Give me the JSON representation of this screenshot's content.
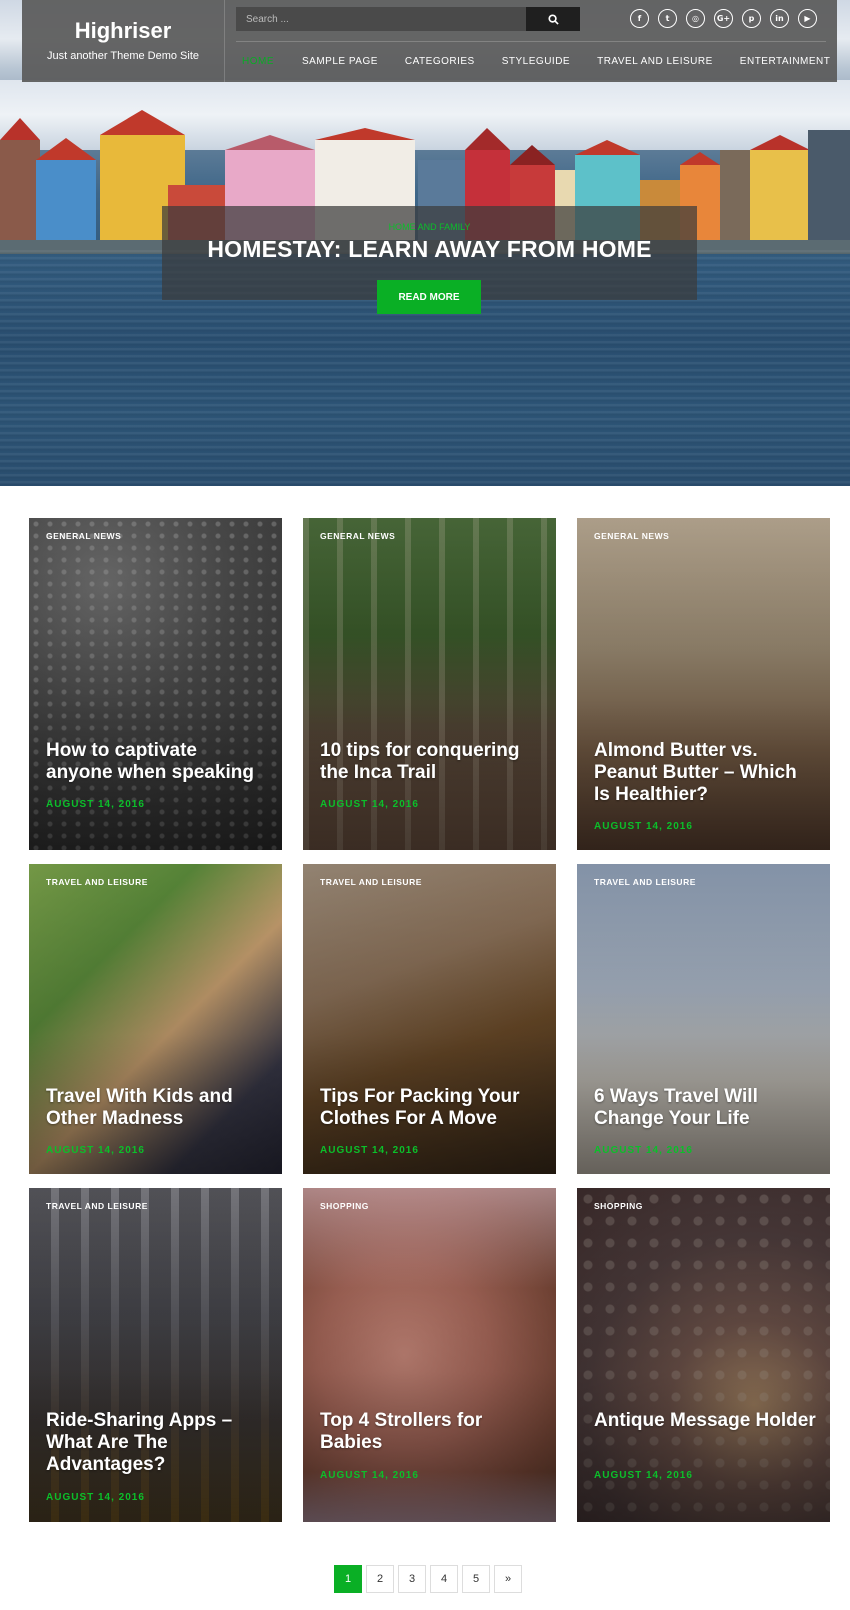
{
  "header": {
    "site_title": "Highriser",
    "site_description": "Just another Theme Demo Site",
    "search": {
      "placeholder": "Search ..."
    },
    "social": [
      "facebook-icon",
      "twitter-icon",
      "instagram-icon",
      "google-plus-icon",
      "pinterest-icon",
      "linkedin-icon",
      "youtube-icon"
    ],
    "social_glyphs": [
      "f",
      "t",
      "◎",
      "G+",
      "p",
      "in",
      "▶"
    ],
    "nav": [
      {
        "label": "HOME",
        "active": true
      },
      {
        "label": "SAMPLE PAGE",
        "active": false
      },
      {
        "label": "CATEGORIES",
        "active": false
      },
      {
        "label": "STYLEGUIDE",
        "active": false
      },
      {
        "label": "TRAVEL AND LEISURE",
        "active": false
      },
      {
        "label": "ENTERTAINMENT",
        "active": false
      }
    ]
  },
  "hero": {
    "category": "HOME AND FAMILY",
    "title": "HOMESTAY: LEARN AWAY FROM HOME",
    "button": "READ MORE"
  },
  "posts": [
    {
      "category": "GENERAL NEWS",
      "title": "How to captivate anyone when speaking",
      "date": "AUGUST 14, 2016"
    },
    {
      "category": "GENERAL NEWS",
      "title": "10 tips for conquering the Inca Trail",
      "date": "AUGUST 14, 2016"
    },
    {
      "category": "GENERAL NEWS",
      "title": "Almond Butter vs. Peanut Butter – Which Is Healthier?",
      "date": "AUGUST 14, 2016"
    },
    {
      "category": "TRAVEL AND LEISURE",
      "title": "Travel With Kids and Other Madness",
      "date": "AUGUST 14, 2016"
    },
    {
      "category": "TRAVEL AND LEISURE",
      "title": "Tips For Packing Your Clothes For A Move",
      "date": "AUGUST 14, 2016"
    },
    {
      "category": "TRAVEL AND LEISURE",
      "title": "6 Ways Travel Will Change Your Life",
      "date": "AUGUST 14, 2016"
    },
    {
      "category": "TRAVEL AND LEISURE",
      "title": "Ride-Sharing Apps – What Are The Advantages?",
      "date": "AUGUST 14, 2016"
    },
    {
      "category": "SHOPPING",
      "title": "Top 4 Strollers for Babies",
      "date": "AUGUST 14, 2016"
    },
    {
      "category": "SHOPPING",
      "title": "Antique Message Holder",
      "date": "AUGUST 14, 2016"
    }
  ],
  "pagination": {
    "pages": [
      "1",
      "2",
      "3",
      "4",
      "5"
    ],
    "current": "1",
    "next": "»"
  },
  "colors": {
    "accent": "#0aaf25",
    "header_bg": "#5a5a5a"
  }
}
